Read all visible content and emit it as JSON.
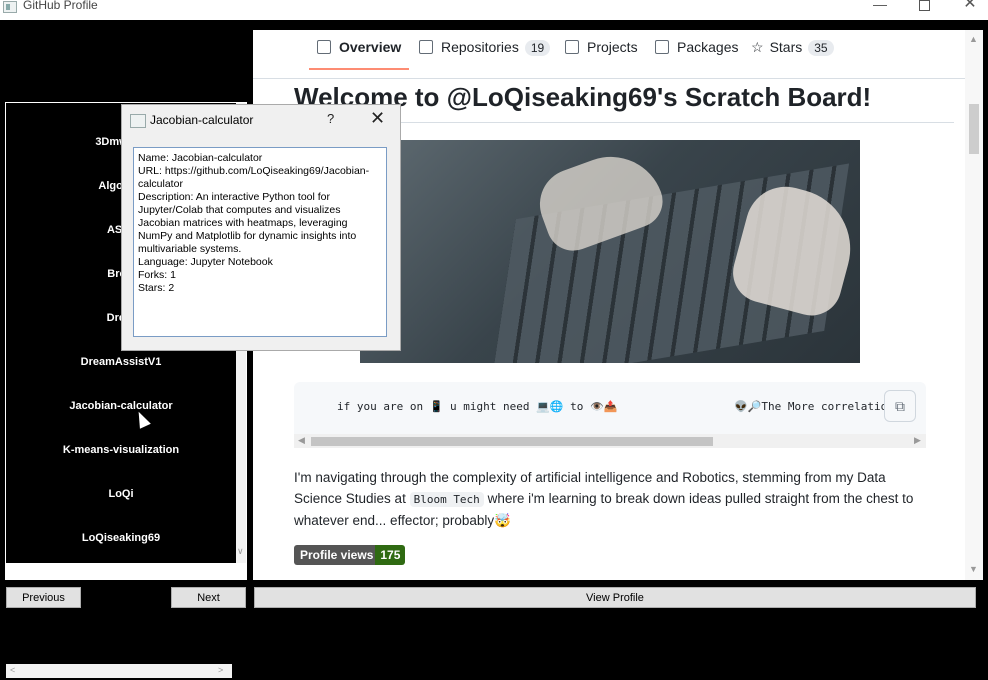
{
  "window": {
    "title": "GitHub Profile"
  },
  "repo_list": {
    "items": [
      {
        "label": "3Dmws_F"
      },
      {
        "label": "Algo_No"
      },
      {
        "label": "ASL_"
      },
      {
        "label": "Brow"
      },
      {
        "label": "Drear"
      },
      {
        "label": "DreamAssistV1"
      },
      {
        "label": "Jacobian-calculator"
      },
      {
        "label": "K-means-visualization"
      },
      {
        "label": "LoQi"
      },
      {
        "label": "LoQiseaking69"
      }
    ]
  },
  "profile_page": {
    "tabs": [
      {
        "label": "Overview",
        "count": "",
        "icon": "book-icon",
        "active": true
      },
      {
        "label": "Repositories",
        "count": "19",
        "icon": "repo-icon"
      },
      {
        "label": "Projects",
        "count": "",
        "icon": "table-icon"
      },
      {
        "label": "Packages",
        "count": "",
        "icon": "package-icon"
      },
      {
        "label": "Stars",
        "count": "35",
        "icon": "star-icon"
      }
    ],
    "heading": "Welcome to @LoQiseaking69's Scratch Board!",
    "code_line": "if you are on 📱 u might need 💻🌐 to 👁️📤",
    "code_line_right": "👽🔎The More correlation",
    "para_before": "I'm navigating through the complexity of artificial intelligence and Robotics, stemming from my Data Science Studies at ",
    "para_code": "Bloom Tech",
    "para_after": " where i'm learning to break down ideas pulled straight from the chest to whatever end... effector; probably🤯",
    "badge_label": "Profile views",
    "badge_value": "175"
  },
  "dialog": {
    "title": "Jacobian-calculator",
    "help": "?",
    "lines": [
      "Name: Jacobian-calculator",
      "URL: https://github.com/LoQiseaking69/Jacobian-calculator",
      "Description: An interactive Python tool for Jupyter/Colab that computes and visualizes Jacobian matrices with heatmaps, leveraging NumPy and Matplotlib for dynamic insights into multivariable systems.",
      "Language: Jupyter Notebook",
      "Forks: 1",
      "Stars: 2"
    ]
  },
  "buttons": {
    "previous": "Previous",
    "next": "Next",
    "view_profile": "View Profile"
  }
}
